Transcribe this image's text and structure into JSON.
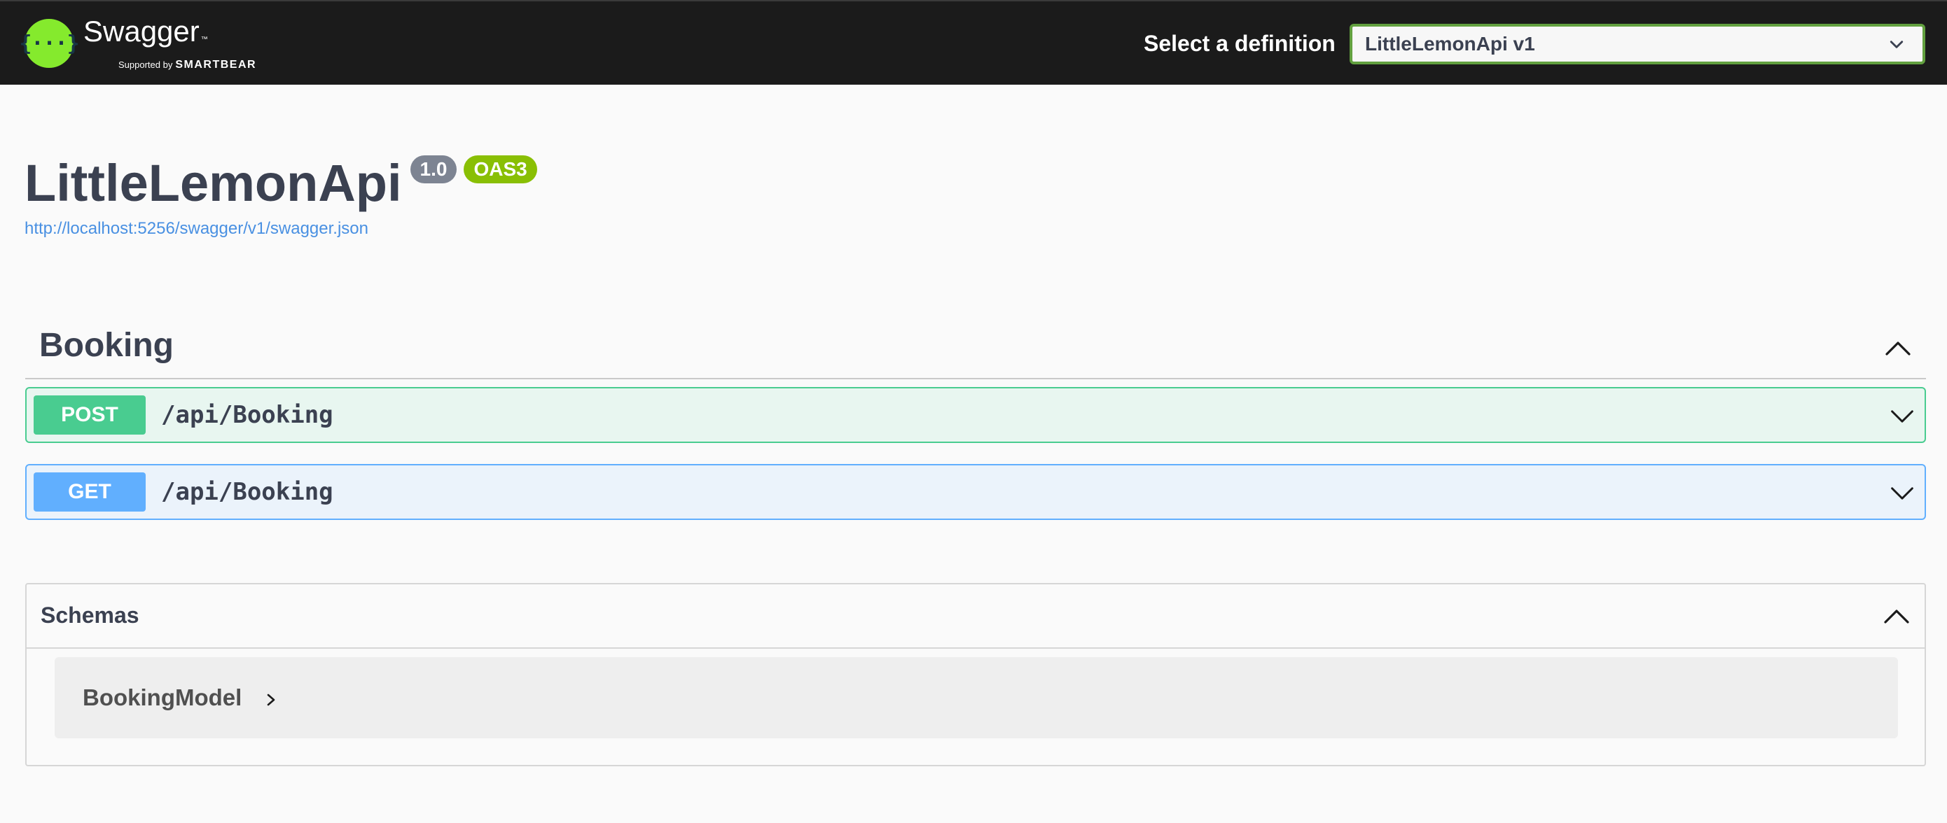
{
  "topbar": {
    "logo_glyph": "{···}",
    "logo_name": "Swagger",
    "logo_tm": "™",
    "supported_by": "Supported by",
    "supported_brand": "SMARTBEAR",
    "definition_label": "Select a definition",
    "definition_selected": "LittleLemonApi v1"
  },
  "info": {
    "title": "LittleLemonApi",
    "version": "1.0",
    "oas": "OAS3",
    "spec_url": "http://localhost:5256/swagger/v1/swagger.json"
  },
  "tag": {
    "name": "Booking",
    "operations": [
      {
        "method": "POST",
        "path": "/api/Booking"
      },
      {
        "method": "GET",
        "path": "/api/Booking"
      }
    ]
  },
  "schemas": {
    "title": "Schemas",
    "models": [
      {
        "name": "BookingModel"
      }
    ]
  },
  "colors": {
    "topbar_bg": "#1b1b1b",
    "logo_green": "#85ea2d",
    "post_green": "#49cc90",
    "get_blue": "#61affe",
    "oas_badge": "#89bf04",
    "version_badge": "#7d8492",
    "link_blue": "#4990e2"
  }
}
